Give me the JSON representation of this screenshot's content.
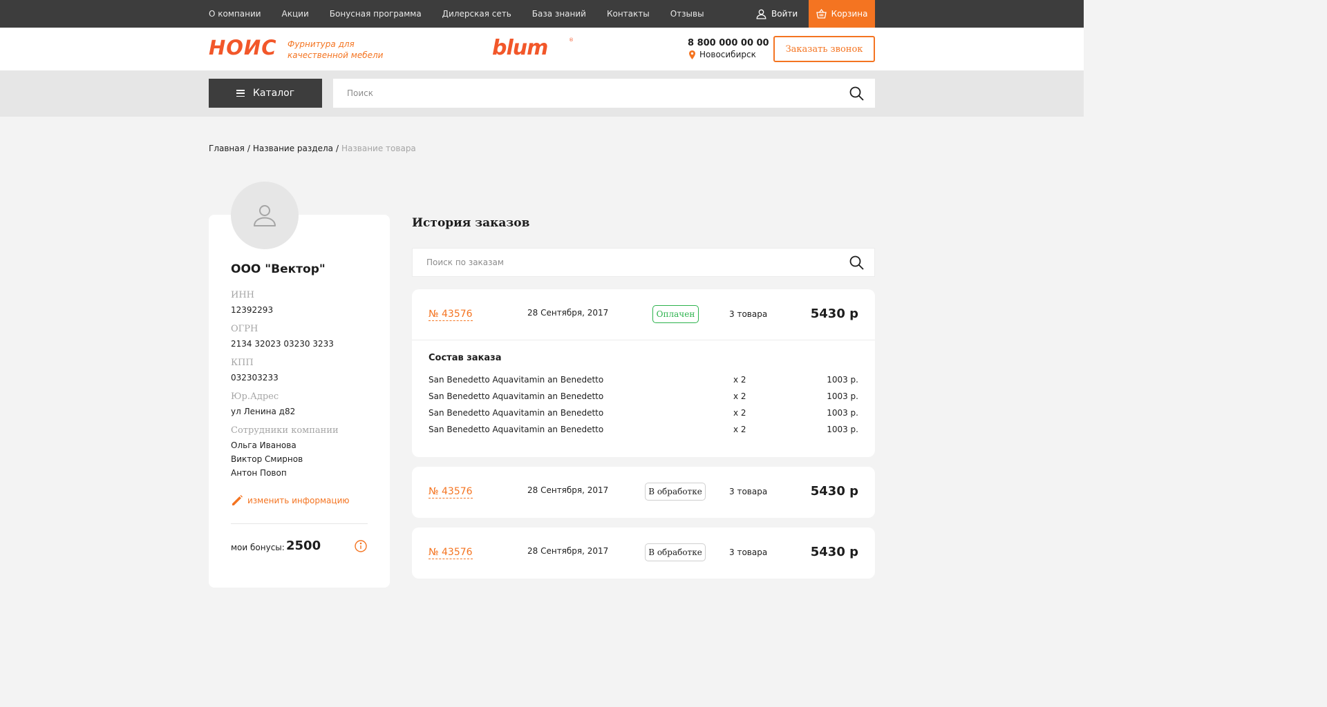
{
  "nav": {
    "items": [
      "О компании",
      "Акции",
      "Бонусная программа",
      "Дилерская сеть",
      "База знаний",
      "Контакты",
      "Отзывы"
    ],
    "login_label": "Войти",
    "cart_label": "Корзина"
  },
  "header": {
    "logo": "НОИС",
    "tagline": "Фурнитура для качественной мебели",
    "brand": "blum",
    "brand_mark": "®",
    "phone": "8 800 000 00 00",
    "city": "Новосибирск",
    "callback_label": "Заказать звонок"
  },
  "catalog": {
    "button_label": "Каталог",
    "search_placeholder": "Поиск"
  },
  "breadcrumb": {
    "items": [
      "Главная",
      "Название раздела"
    ],
    "separator": "/",
    "current": "Название товара"
  },
  "profile": {
    "company": "ООО \"Вектор\"",
    "fields": [
      {
        "label": "ИНН",
        "value": "12392293"
      },
      {
        "label": "ОГРН",
        "value": "2134 32023 03230 3233"
      },
      {
        "label": "КПП",
        "value": "032303233"
      },
      {
        "label": "Юр.Адрес",
        "value": "ул Ленина д82"
      }
    ],
    "employees_label": "Сотрудники компании",
    "employees": [
      "Ольга Иванова",
      "Виктор Смирнов",
      "Антон Повоп"
    ],
    "edit_label": "изменить информацию",
    "bonus_label": "мои бонусы:",
    "bonus_value": "2500"
  },
  "orders": {
    "title": "История заказов",
    "search_placeholder": "Поиск по заказам",
    "composition_label": "Состав заказа",
    "list": [
      {
        "number": "№ 43576",
        "date": "28 Сентября, 2017",
        "status": "Оплачен",
        "status_color": "#2bb24c",
        "count": "3 товара",
        "total": "5430 р",
        "expanded": true,
        "items": [
          {
            "name": "San Benedetto Aquavitamin an Benedetto",
            "qty": "x 2",
            "price": "1003 р."
          },
          {
            "name": "San Benedetto Aquavitamin an Benedetto",
            "qty": "x 2",
            "price": "1003 р."
          },
          {
            "name": "San Benedetto Aquavitamin an Benedetto",
            "qty": "x 2",
            "price": "1003 р."
          },
          {
            "name": "San Benedetto Aquavitamin an Benedetto",
            "qty": "x 2",
            "price": "1003 р."
          }
        ]
      },
      {
        "number": "№ 43576",
        "date": "28 Сентября, 2017",
        "status": "В обработке",
        "count": "3 товара",
        "total": "5430 р",
        "expanded": false
      },
      {
        "number": "№ 43576",
        "date": "28 Сентября, 2017",
        "status": "В обработке",
        "count": "3 товара",
        "total": "5430 р",
        "expanded": false
      }
    ]
  },
  "colors": {
    "accent": "#f47421",
    "dark": "#3d3d3d",
    "paid": "#2bb24c"
  },
  "icons": {
    "user": "user-icon",
    "cart": "basket-icon",
    "location": "map-pin-icon",
    "menu": "burger-menu-icon",
    "search": "search-icon",
    "avatar": "user-avatar-icon",
    "edit": "pencil-icon",
    "info": "info-circle-icon"
  }
}
